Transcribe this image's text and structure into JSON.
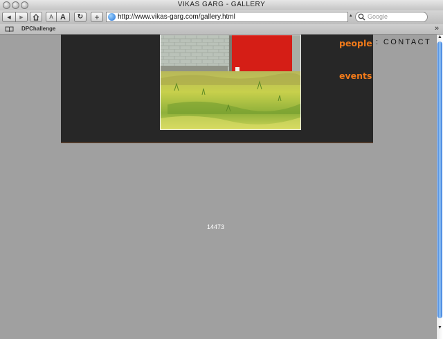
{
  "window": {
    "title": "VIKAS GARG - GALLERY"
  },
  "toolbar": {
    "url": "http://www.vikas-garg.com/gallery.html",
    "search_placeholder": "Google",
    "back_glyph": "◀",
    "forward_glyph": "▶",
    "text_small": "A",
    "text_large": "A",
    "reload_glyph": "↻",
    "add_glyph": "+"
  },
  "bookmarks": {
    "items": [
      {
        "label": "DPChallenge"
      }
    ],
    "overflow_glyph": "»"
  },
  "page": {
    "nav": {
      "people": "people",
      "events": "events",
      "contact": ": CONTACT"
    },
    "counter": "14473",
    "accent_color": "#f07a1a",
    "panel_color": "#272727",
    "background_color": "#a0a0a0"
  },
  "icons": {
    "home": "home-icon",
    "globe": "globe-icon",
    "search": "search-icon",
    "bookmarks": "book-icon"
  }
}
